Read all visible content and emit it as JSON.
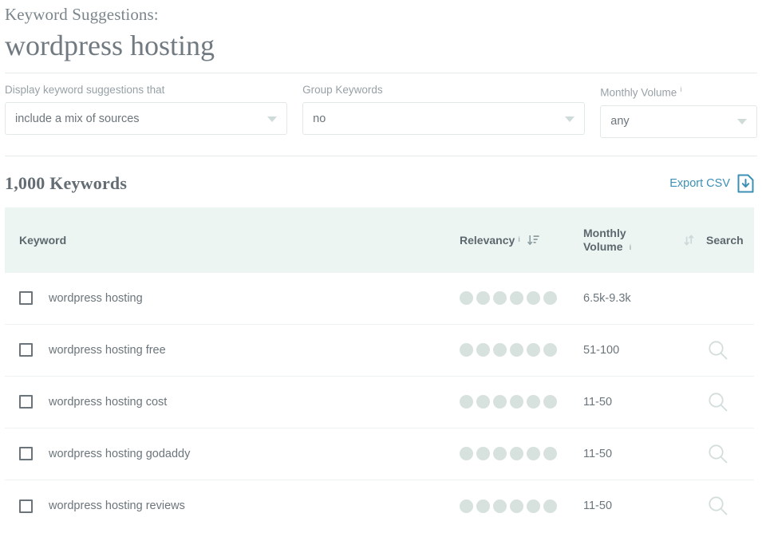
{
  "header": {
    "eyebrow": "Keyword Suggestions:",
    "title": "wordpress hosting"
  },
  "filters": [
    {
      "label": "Display keyword suggestions that",
      "value": "include a mix of sources",
      "has_info": false,
      "info_glyph": ""
    },
    {
      "label": "Group Keywords",
      "value": "no",
      "has_info": false,
      "info_glyph": ""
    },
    {
      "label": "Monthly Volume",
      "value": "any",
      "has_info": true,
      "info_glyph": "i"
    }
  ],
  "results": {
    "count_label": "1,000 Keywords",
    "export_label": "Export CSV",
    "export_icon": "download-file-icon"
  },
  "table": {
    "columns": {
      "keyword": "Keyword",
      "relevancy": "Relevancy",
      "monthly_volume_line1": "Monthly",
      "monthly_volume_line2": "Volume",
      "search": "Search"
    },
    "info_glyph": "i",
    "relevancy_sort_icon": "sort-descending-icon",
    "volume_sort_icon": "sort-unsorted-icon",
    "relevancy_max_dots": 6,
    "rows": [
      {
        "keyword": "wordpress hosting",
        "checked": false,
        "relevancy_dots": 6,
        "monthly_volume": "6.5k-9.3k",
        "has_search": false
      },
      {
        "keyword": "wordpress hosting free",
        "checked": false,
        "relevancy_dots": 6,
        "monthly_volume": "51-100",
        "has_search": true
      },
      {
        "keyword": "wordpress hosting cost",
        "checked": false,
        "relevancy_dots": 6,
        "monthly_volume": "11-50",
        "has_search": true
      },
      {
        "keyword": "wordpress hosting godaddy",
        "checked": false,
        "relevancy_dots": 6,
        "monthly_volume": "11-50",
        "has_search": true
      },
      {
        "keyword": "wordpress hosting reviews",
        "checked": false,
        "relevancy_dots": 6,
        "monthly_volume": "11-50",
        "has_search": true
      }
    ]
  },
  "colors": {
    "accent": "#3d8fb5",
    "header_bg": "#edf5f3",
    "dot": "#d7e1de",
    "text": "#6b757b",
    "muted": "#97a1a6"
  }
}
